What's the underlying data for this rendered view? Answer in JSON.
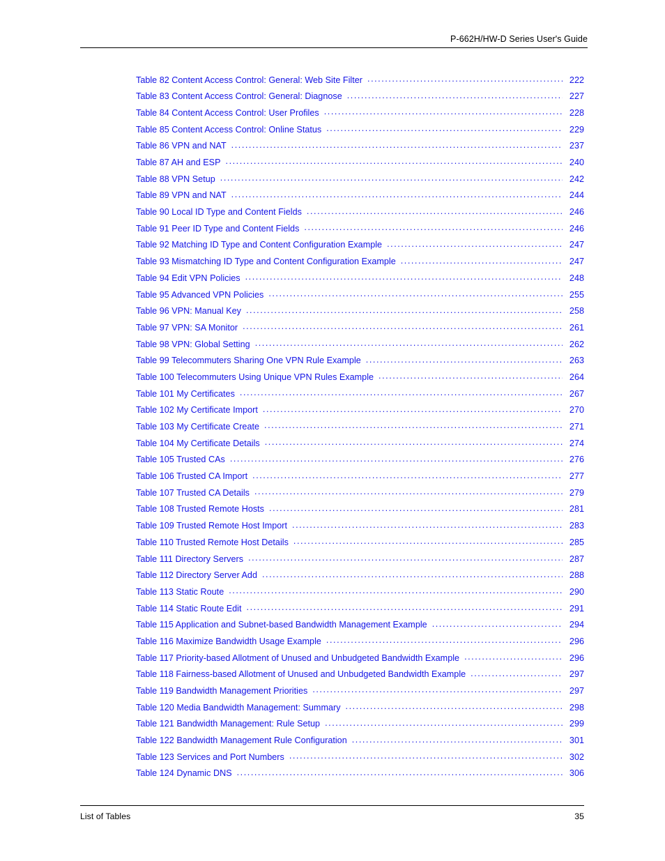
{
  "header": {
    "title": "P-662H/HW-D Series User's Guide"
  },
  "toc": {
    "entries": [
      {
        "label": "Table 82 Content Access Control: General: Web Site Filter",
        "page": "222"
      },
      {
        "label": "Table 83 Content Access Control: General: Diagnose",
        "page": "227"
      },
      {
        "label": "Table 84 Content Access Control: User Profiles",
        "page": "228"
      },
      {
        "label": "Table 85 Content Access Control: Online Status",
        "page": "229"
      },
      {
        "label": "Table 86 VPN and NAT",
        "page": "237"
      },
      {
        "label": "Table 87 AH and ESP",
        "page": "240"
      },
      {
        "label": "Table 88 VPN Setup",
        "page": "242"
      },
      {
        "label": "Table 89 VPN and NAT",
        "page": "244"
      },
      {
        "label": "Table 90 Local ID Type and Content Fields",
        "page": "246"
      },
      {
        "label": "Table 91 Peer ID Type and Content Fields",
        "page": "246"
      },
      {
        "label": "Table 92 Matching ID Type and Content Configuration Example",
        "page": "247"
      },
      {
        "label": "Table 93 Mismatching ID Type and Content Configuration Example",
        "page": "247"
      },
      {
        "label": "Table 94 Edit VPN Policies",
        "page": "248"
      },
      {
        "label": "Table 95 Advanced VPN Policies",
        "page": "255"
      },
      {
        "label": "Table 96 VPN: Manual Key",
        "page": "258"
      },
      {
        "label": "Table 97 VPN: SA Monitor",
        "page": "261"
      },
      {
        "label": "Table 98 VPN: Global Setting",
        "page": "262"
      },
      {
        "label": "Table 99 Telecommuters Sharing One VPN Rule Example",
        "page": "263"
      },
      {
        "label": "Table 100 Telecommuters Using Unique VPN Rules Example",
        "page": "264"
      },
      {
        "label": "Table 101 My Certificates",
        "page": "267"
      },
      {
        "label": "Table 102 My Certificate Import",
        "page": "270"
      },
      {
        "label": "Table 103 My Certificate Create",
        "page": "271"
      },
      {
        "label": "Table 104 My Certificate Details",
        "page": "274"
      },
      {
        "label": "Table 105 Trusted CAs",
        "page": "276"
      },
      {
        "label": "Table 106 Trusted CA Import",
        "page": "277"
      },
      {
        "label": "Table 107 Trusted CA Details",
        "page": "279"
      },
      {
        "label": "Table 108 Trusted Remote Hosts",
        "page": "281"
      },
      {
        "label": "Table 109 Trusted Remote Host Import",
        "page": "283"
      },
      {
        "label": "Table 110 Trusted Remote Host Details",
        "page": "285"
      },
      {
        "label": "Table 111 Directory Servers",
        "page": "287"
      },
      {
        "label": "Table 112 Directory Server Add",
        "page": "288"
      },
      {
        "label": "Table 113 Static Route",
        "page": "290"
      },
      {
        "label": "Table 114 Static Route Edit",
        "page": "291"
      },
      {
        "label": "Table 115 Application and Subnet-based Bandwidth Management Example",
        "page": "294"
      },
      {
        "label": "Table 116 Maximize Bandwidth Usage Example",
        "page": "296"
      },
      {
        "label": "Table 117 Priority-based Allotment of Unused and Unbudgeted Bandwidth Example",
        "page": "296"
      },
      {
        "label": "Table 118 Fairness-based Allotment of Unused and Unbudgeted Bandwidth Example",
        "page": "297"
      },
      {
        "label": "Table 119 Bandwidth Management Priorities",
        "page": "297"
      },
      {
        "label": "Table 120 Media Bandwidth Management: Summary",
        "page": "298"
      },
      {
        "label": "Table 121 Bandwidth Management: Rule Setup",
        "page": "299"
      },
      {
        "label": "Table 122 Bandwidth Management Rule Configuration",
        "page": "301"
      },
      {
        "label": "Table 123 Services and Port Numbers",
        "page": "302"
      },
      {
        "label": "Table 124 Dynamic DNS",
        "page": "306"
      }
    ]
  },
  "footer": {
    "section": "List of Tables",
    "page_number": "35"
  },
  "colors": {
    "link": "#1414e6",
    "text": "#000000",
    "background": "#ffffff"
  }
}
